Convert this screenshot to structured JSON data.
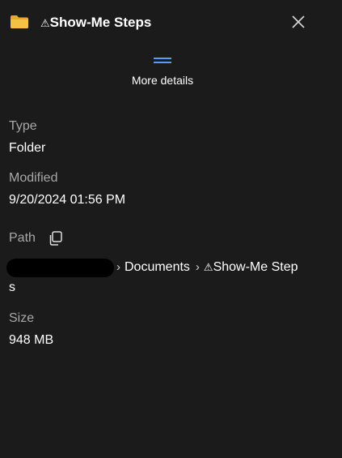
{
  "header": {
    "title_prefix": "⚠",
    "title": "Show-Me Steps",
    "folder_icon": "folder-icon",
    "close_icon": "close-icon",
    "folder_color": "#f3c144"
  },
  "more_details": {
    "label": "More details",
    "icon": "menu-lines-icon",
    "accent": "#5b9bff"
  },
  "properties": {
    "type_label": "Type",
    "type_value": "Folder",
    "modified_label": "Modified",
    "modified_value": "9/20/2024 01:56 PM",
    "path_label": "Path",
    "path_crumbs": [
      "Documents",
      "Show-Me Step"
    ],
    "path_crumb_prefix": "⚠",
    "path_wrap": "s",
    "size_label": "Size",
    "size_value": "948 MB"
  }
}
